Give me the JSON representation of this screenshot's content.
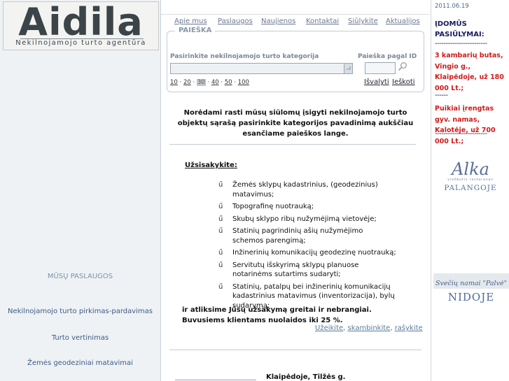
{
  "logo": {
    "name": "Aidila",
    "subtitle": "Nekilnojamojo turto agentūra"
  },
  "left_nav": {
    "title": "MŪSŲ PASLAUGOS",
    "items": [
      {
        "label": "Nekilnojamojo turto pirkimas-pardavimas"
      },
      {
        "label": "Turto vertinimas"
      },
      {
        "label": "Žemės geodeziniai matavimai"
      }
    ]
  },
  "menu": {
    "items": [
      {
        "label": "Apie mus"
      },
      {
        "label": "Paslaugos"
      },
      {
        "label": "Naujienos"
      },
      {
        "label": "Kontaktai"
      },
      {
        "label": "Siūlykite"
      },
      {
        "label": "Aktualijos"
      }
    ]
  },
  "search": {
    "legend": "PAIEŠKA",
    "category_label": "Pasirinkite nekilnojamojo turto kategorija",
    "category_value": "",
    "id_label": "Paieška pagal ID",
    "id_value": "",
    "per_page": {
      "options": [
        "10",
        "20",
        "30",
        "40",
        "50",
        "100"
      ],
      "selected": "30"
    },
    "clear_label": "Išvalyti",
    "search_label": "Ieškoti"
  },
  "main": {
    "intro": "Norėdami rasti mūsų siūlomų įsigyti nekilnojamojo turto objektų sąrašą pasirinkite kategorijos pavadinimą aukščiau esančiame paieškos lange.",
    "order_title": "Užsisakykite:",
    "bullet": "ű",
    "services": [
      "Žemės sklypų kadastrinius, (geodezinius) matavimus;",
      "Topografinę nuotrauką;",
      "Skubų sklypo ribų nužymėjimą vietovėje;",
      "Statinių pagrindinių ašių nužymėjimo schemos parengimą;",
      "Inžinerinių komunikacijų geodezinę nuotrauką;",
      "Servitutų išskyrimą sklypų planuose notarinėms sutartims sudaryti;",
      "Statinių, patalpų bei inžinerinių komunikacijų kadastrinius matavimus (inventorizacija), bylų sudarymą;"
    ],
    "accept_line1": "ir atliksime Jūsų užsakymą greitai ir nebrangiai.",
    "accept_line2": "Buvusiems klientams nuolaidos iki 25 %.",
    "contact_links": [
      "Užeikite",
      "skambinkite",
      "rašykite"
    ],
    "address": "Klaipėdoje, Tilžės g."
  },
  "right": {
    "date": "2011.06.19",
    "heading": "ĮDOMŪS PASIŪLYMAI:",
    "dashes": "------------------------",
    "offer1": "3 kambarių butas, Vingio g., Klaipėdoje, už 180 000 Lt.;",
    "separator": "------",
    "offer2": "Puikiai įrengtas gyv. namas, Kalotėje, už 700 000 Lt.;",
    "alka": {
      "script": "Alka",
      "small": "viešbutis restoranas",
      "place": "PALANGOJE"
    },
    "svec": "Svečių namai \"Palvė\"",
    "nidoje": "NIDOJE"
  },
  "colors": {
    "offer_red": "#d11a1a",
    "link_blue": "#3e5a85",
    "heading_navy": "#1a1a5e"
  }
}
